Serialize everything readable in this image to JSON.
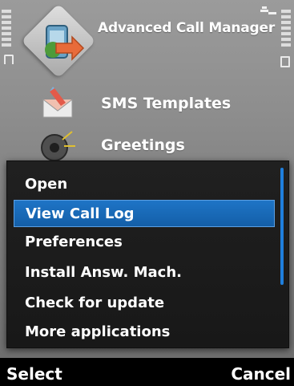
{
  "status": {
    "signal_icon": "signal-bars-icon",
    "battery_icon": "battery-icon",
    "network_icon": "3g-network-icon"
  },
  "header": {
    "app_title": "Advanced Call Manager",
    "app_icon": "call-manager-logo-icon"
  },
  "background_items": [
    {
      "label": "SMS Templates",
      "icon": "sms-envelope-icon"
    },
    {
      "label": "Greetings",
      "icon": "greetings-speaker-icon"
    }
  ],
  "menu": {
    "items": [
      {
        "label": "Open"
      },
      {
        "label": "View Call Log",
        "selected": true
      },
      {
        "label": "Preferences"
      },
      {
        "label": "Install Answ. Mach."
      },
      {
        "label": "Check for update"
      },
      {
        "label": "More applications"
      }
    ],
    "accent_color": "#1e74c6"
  },
  "softkeys": {
    "left_label": "Select",
    "right_label": "Cancel"
  }
}
